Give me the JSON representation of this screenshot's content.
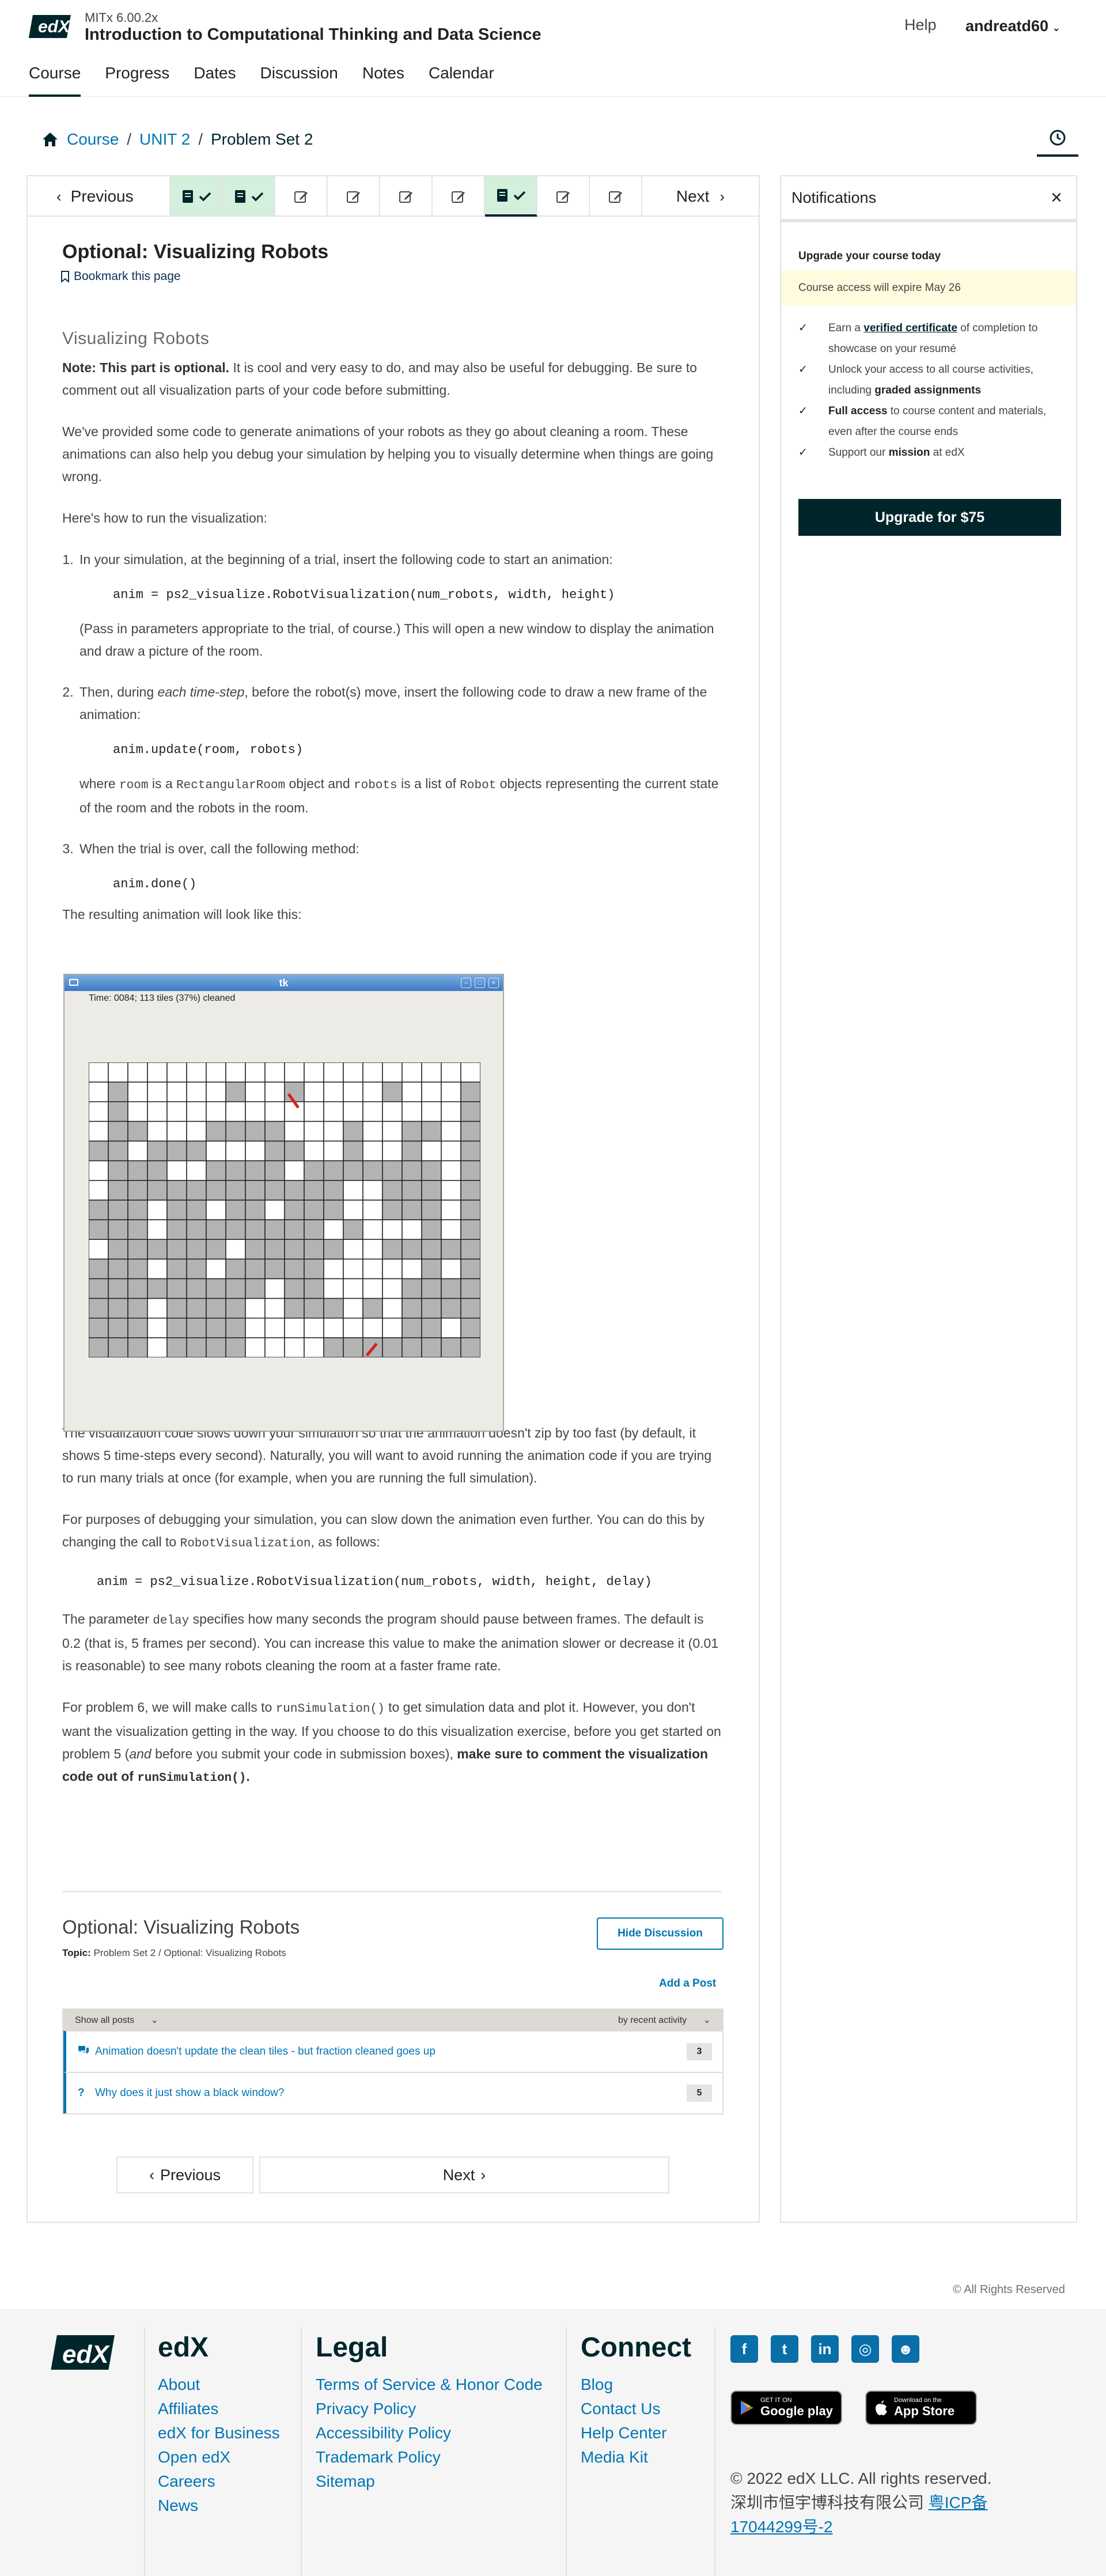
{
  "header": {
    "course_number": "MITx 6.00.2x",
    "course_title": "Introduction to Computational Thinking and Data Science",
    "help": "Help",
    "username": "andreatd60",
    "tabs": [
      "Course",
      "Progress",
      "Dates",
      "Discussion",
      "Notes",
      "Calendar"
    ]
  },
  "breadcrumb": [
    "Course",
    "UNIT 2",
    "Problem Set 2"
  ],
  "sequence_nav": {
    "previous": "Previous",
    "next": "Next",
    "tabs": [
      {
        "icon": "problem-icon",
        "state": "completed"
      },
      {
        "icon": "problem-icon",
        "state": "completed"
      },
      {
        "icon": "edit-icon",
        "state": "default"
      },
      {
        "icon": "edit-icon",
        "state": "default"
      },
      {
        "icon": "edit-icon",
        "state": "default"
      },
      {
        "icon": "edit-icon",
        "state": "default"
      },
      {
        "icon": "problem-icon",
        "state": "completed-current"
      },
      {
        "icon": "edit-icon",
        "state": "default"
      },
      {
        "icon": "edit-icon",
        "state": "default"
      }
    ]
  },
  "unit": {
    "title": "Optional: Visualizing Robots",
    "bookmark": "Bookmark this page"
  },
  "problem": {
    "heading": "Visualizing Robots",
    "note_bold": "Note: This part is optional.",
    "note_rest": " It is cool and very easy to do, and may also be useful for debugging. Be sure to comment out all visualization parts of your code before submitting.",
    "p_provided": "We've provided some code to generate animations of your robots as they go about cleaning a room. These animations can also help you debug your simulation by helping you to visually determine when things are going wrong.",
    "p_howto": "Here's how to run the visualization:",
    "step1": "In your simulation, at the beginning of a trial, insert the following code to start an animation:",
    "step1_code": "anim = ps2_visualize.RobotVisualization(num_robots, width, height)",
    "step1_after": "(Pass in parameters appropriate to the trial, of course.) This will open a new window to display the animation and draw a picture of the room.",
    "step2_a": "Then, during ",
    "step2_em": "each time-step",
    "step2_b": ", before the robot(s) move, insert the following code to draw a new frame of the animation:",
    "step2_code": "anim.update(room, robots)",
    "step2_after_a": "where ",
    "step2_code_room": "room",
    "step2_after_b": " is a ",
    "step2_code_rect": "RectangularRoom",
    "step2_after_c": " object and ",
    "step2_code_robots": "robots",
    "step2_after_d": " is a list of ",
    "step2_code_robot": "Robot",
    "step2_after_e": " objects representing the current state of the room and the robots in the room.",
    "step3": "When the trial is over, call the following method:",
    "step3_code": "anim.done()",
    "p_result": "The resulting animation will look like this:",
    "p_slows": "The visualization code slows down your simulation so that the animation doesn't zip by too fast (by default, it shows 5 time-steps every second). Naturally, you will want to avoid running the animation code if you are trying to run many trials at once (for example, when you are running the full simulation).",
    "p_debug_a": "For purposes of debugging your simulation, you can slow down the animation even further. You can do this by changing the call to ",
    "p_debug_code": "RobotVisualization",
    "p_debug_b": ", as follows:",
    "delay_code": "anim = ps2_visualize.RobotVisualization(num_robots, width, height, delay)",
    "p_param_a": "The parameter ",
    "p_param_code": "delay",
    "p_param_b": " specifies how many seconds the program should pause between frames. The default is 0.2 (that is, 5 frames per second). You can increase this value to make the animation slower or decrease it (0.01 is reasonable) to see many robots cleaning the room at a faster frame rate.",
    "p_p6_a": "For problem 6, we will make calls to ",
    "p_p6_code": "runSimulation()",
    "p_p6_b": " to get simulation data and plot it. However, you don't want the visualization getting in the way. If you choose to do this visualization exercise, before you get started on problem 5 (",
    "p_p6_em": "and",
    "p_p6_c": " before you submit your code in submission boxes), ",
    "p_p6_bold": "make sure to comment the visualization code out of ",
    "p_p6_bold_code": "runSimulation()",
    "p_p6_end": "."
  },
  "simulation": {
    "window_title": "tk",
    "status": "Time: 0084; 113 tiles (37%) cleaned",
    "grid_cols": 20,
    "grid_rows": 15,
    "tiles_cleaned": 113,
    "percent_cleaned": 37,
    "dirty_color": "#b3b3b3",
    "clean_color": "#ffffff",
    "robot_color": "#d42020"
  },
  "discussion": {
    "title": "Optional: Visualizing Robots",
    "topic_label": "Topic:",
    "topic_value": "Problem Set 2 / Optional: Visualizing Robots",
    "hide_button": "Hide Discussion",
    "add_post": "Add a Post",
    "filter": "Show all posts",
    "sort": "by recent activity",
    "posts": [
      {
        "icon": "discussion-icon",
        "title": "Animation doesn't update the clean tiles - but fraction cleaned goes up",
        "count": "3"
      },
      {
        "icon": "question-icon",
        "title": "Why does it just show a black window?",
        "count": "5"
      }
    ]
  },
  "bottom_nav": {
    "previous": "Previous",
    "next": "Next"
  },
  "notifications": {
    "title": "Notifications",
    "upgrade_title": "Upgrade your course today",
    "expire": "Course access will expire May 26",
    "benefit1_a": "Earn a ",
    "benefit1_link": "verified certificate",
    "benefit1_b": " of completion to showcase on your resumé",
    "benefit2_a": "Unlock your access to all course activities, including ",
    "benefit2_bold": "graded assignments",
    "benefit3_bold": "Full access",
    "benefit3_b": " to course content and materials, even after the course ends",
    "benefit4_a": "Support our ",
    "benefit4_bold": "mission",
    "benefit4_b": " at edX",
    "upgrade_button": "Upgrade for $75"
  },
  "footer": {
    "rights": "© All Rights Reserved",
    "edx_heading": "edX",
    "edx_links": [
      "About",
      "Affiliates",
      "edX for Business",
      "Open edX",
      "Careers",
      "News"
    ],
    "legal_heading": "Legal",
    "legal_links": [
      "Terms of Service & Honor Code",
      "Privacy Policy",
      "Accessibility Policy",
      "Trademark Policy",
      "Sitemap"
    ],
    "connect_heading": "Connect",
    "connect_links": [
      "Blog",
      "Contact Us",
      "Help Center",
      "Media Kit"
    ],
    "google_small": "GET IT ON",
    "google_big": "Google play",
    "apple_small": "Download on the",
    "apple_big": "App Store",
    "copyright": "© 2022 edX LLC. All rights reserved.",
    "icp_text": "深圳市恒宇博科技有限公司 ",
    "icp_link_a": "粤ICP备",
    "icp_link_b": "17044299号-2"
  },
  "colors": {
    "accent": "#0075b4",
    "brand_dark": "#00262b",
    "completed_tab": "#d4f0dd",
    "banner": "#fffbde"
  }
}
